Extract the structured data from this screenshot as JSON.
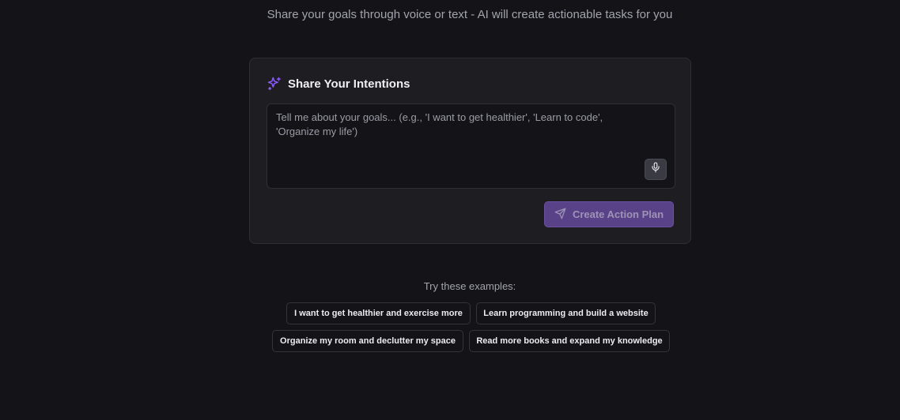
{
  "header": {
    "subtitle": "Share your goals through voice or text - AI will create actionable tasks for you"
  },
  "card": {
    "icon": "sparkles-icon",
    "title": "Share Your Intentions",
    "input": {
      "value": "",
      "placeholder": "Tell me about your goals... (e.g., 'I want to get healthier', 'Learn to code', 'Organize my life')"
    },
    "mic_icon": "microphone-icon",
    "submit": {
      "icon": "send-icon",
      "label": "Create Action Plan"
    }
  },
  "examples": {
    "label": "Try these examples:",
    "items": [
      "I want to get healthier and exercise more",
      "Learn programming and build a website",
      "Organize my room and declutter my space",
      "Read more books and expand my knowledge"
    ]
  },
  "colors": {
    "background": "#131318",
    "card": "#1d1d22",
    "accent": "#8b5cf6",
    "button": "#5a4289"
  }
}
